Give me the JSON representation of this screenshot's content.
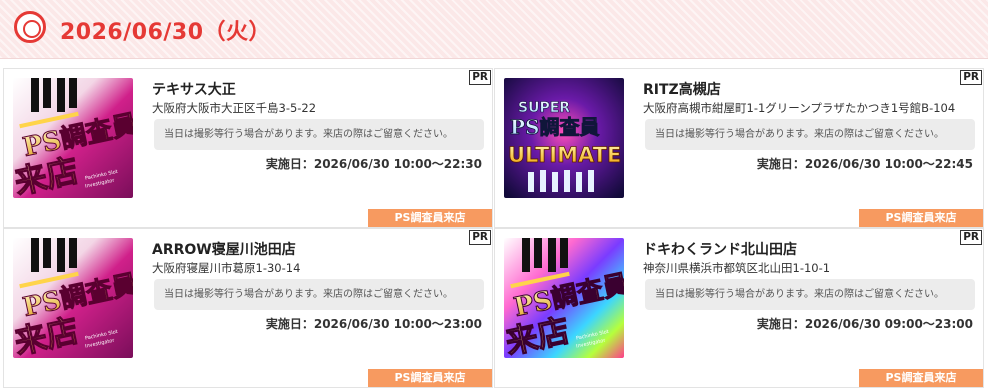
{
  "header": {
    "date": "2026/06/30（火）",
    "accent_color": "#e53935",
    "icon": "target-circle-icon"
  },
  "cards": [
    {
      "pr": "PR",
      "name": "テキサス大正",
      "address": "大阪府大阪市大正区千島3-5-22",
      "notice": "当日は撮影等行う場合があります。来店の際はご留意ください。",
      "date_line": "実施日：2026/06/30 10:00〜22:30",
      "tag": "PS調査員来店",
      "image": "ps-investigator-visit-banner"
    },
    {
      "pr": "PR",
      "name": "RITZ高槻店",
      "address": "大阪府高槻市紺屋町1-1グリーンプラザたかつき1号館B-104",
      "notice": "当日は撮影等行う場合があります。来店の際はご留意ください。",
      "date_line": "実施日：2026/06/30 10:00〜22:45",
      "tag": "PS調査員来店",
      "image": "super-ps-investigator-ultimate-banner"
    },
    {
      "pr": "PR",
      "name": "ARROW寝屋川池田店",
      "address": "大阪府寝屋川市葛原1-30-14",
      "notice": "当日は撮影等行う場合があります。来店の際はご留意ください。",
      "date_line": "実施日：2026/06/30 10:00〜23:00",
      "tag": "PS調査員来店",
      "image": "ps-investigator-visit-banner"
    },
    {
      "pr": "PR",
      "name": "ドキわくランド北山田店",
      "address": "神奈川県横浜市都筑区北山田1-10-1",
      "notice": "当日は撮影等行う場合があります。来店の際はご留意ください。",
      "date_line": "実施日：2026/06/30 09:00〜23:00",
      "tag": "PS調査員来店",
      "image": "ps-investigator-visit-banner"
    }
  ],
  "colors": {
    "tag_bg": "#f79a60",
    "header_bg": "#fbe8e8",
    "notice_bg": "#ececec"
  }
}
